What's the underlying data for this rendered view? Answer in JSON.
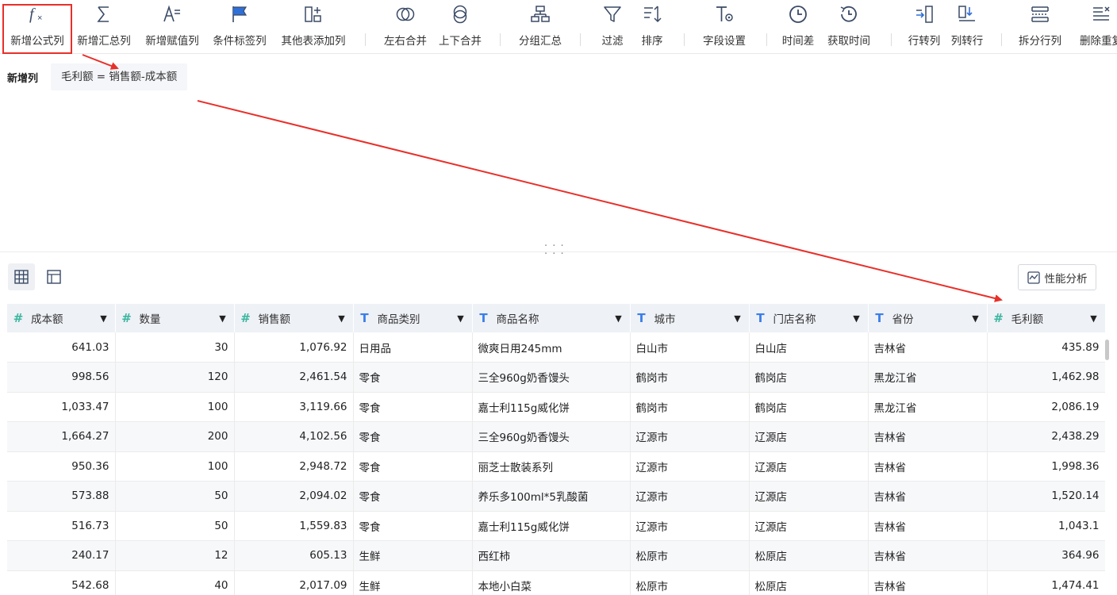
{
  "toolbar": {
    "items": [
      {
        "label": "新增公式列",
        "icon": "formula-fx-icon"
      },
      {
        "label": "新增汇总列",
        "icon": "sigma-icon"
      },
      {
        "label": "新增赋值列",
        "icon": "assign-value-icon"
      },
      {
        "label": "条件标签列",
        "icon": "condition-flag-icon"
      },
      {
        "label": "其他表添加列",
        "icon": "add-column-icon"
      },
      {
        "label": "左右合并",
        "icon": "merge-horizontal-icon"
      },
      {
        "label": "上下合并",
        "icon": "merge-vertical-icon"
      },
      {
        "label": "分组汇总",
        "icon": "group-summary-icon"
      },
      {
        "label": "过滤",
        "icon": "filter-icon"
      },
      {
        "label": "排序",
        "icon": "sort-icon"
      },
      {
        "label": "字段设置",
        "icon": "field-settings-icon"
      },
      {
        "label": "时间差",
        "icon": "clock-icon"
      },
      {
        "label": "获取时间",
        "icon": "clock-fetch-icon"
      },
      {
        "label": "行转列",
        "icon": "row-to-column-icon"
      },
      {
        "label": "列转行",
        "icon": "column-to-row-icon"
      },
      {
        "label": "拆分行列",
        "icon": "split-rows-icon"
      },
      {
        "label": "删除重复",
        "icon": "delete-duplicate-icon"
      }
    ]
  },
  "formula": {
    "section_title": "新增列",
    "expression": "毛利额 = 销售额-成本额"
  },
  "view": {
    "perf_label": "性能分析"
  },
  "table": {
    "columns": [
      {
        "name": "成本额",
        "type": "number",
        "type_icon": "#"
      },
      {
        "name": "数量",
        "type": "number",
        "type_icon": "#"
      },
      {
        "name": "销售额",
        "type": "number",
        "type_icon": "#"
      },
      {
        "name": "商品类别",
        "type": "text",
        "type_icon": "T"
      },
      {
        "name": "商品名称",
        "type": "text",
        "type_icon": "T"
      },
      {
        "name": "城市",
        "type": "text",
        "type_icon": "T"
      },
      {
        "name": "门店名称",
        "type": "text",
        "type_icon": "T"
      },
      {
        "name": "省份",
        "type": "text",
        "type_icon": "T"
      },
      {
        "name": "毛利额",
        "type": "number",
        "type_icon": "#"
      }
    ],
    "rows": [
      [
        "641.03",
        "30",
        "1,076.92",
        "日用品",
        "微爽日用245mm",
        "白山市",
        "白山店",
        "吉林省",
        "435.89"
      ],
      [
        "998.56",
        "120",
        "2,461.54",
        "零食",
        "三全960g奶香馒头",
        "鹤岗市",
        "鹤岗店",
        "黑龙江省",
        "1,462.98"
      ],
      [
        "1,033.47",
        "100",
        "3,119.66",
        "零食",
        "嘉士利115g威化饼",
        "鹤岗市",
        "鹤岗店",
        "黑龙江省",
        "2,086.19"
      ],
      [
        "1,664.27",
        "200",
        "4,102.56",
        "零食",
        "三全960g奶香馒头",
        "辽源市",
        "辽源店",
        "吉林省",
        "2,438.29"
      ],
      [
        "950.36",
        "100",
        "2,948.72",
        "零食",
        "丽芝士散装系列",
        "辽源市",
        "辽源店",
        "吉林省",
        "1,998.36"
      ],
      [
        "573.88",
        "50",
        "2,094.02",
        "零食",
        "养乐多100ml*5乳酸菌",
        "辽源市",
        "辽源店",
        "吉林省",
        "1,520.14"
      ],
      [
        "516.73",
        "50",
        "1,559.83",
        "零食",
        "嘉士利115g威化饼",
        "辽源市",
        "辽源店",
        "吉林省",
        "1,043.1"
      ],
      [
        "240.17",
        "12",
        "605.13",
        "生鲜",
        "西红柿",
        "松原市",
        "松原店",
        "吉林省",
        "364.96"
      ],
      [
        "542.68",
        "40",
        "2,017.09",
        "生鲜",
        "本地小白菜",
        "松原市",
        "松原店",
        "吉林省",
        "1,474.41"
      ]
    ]
  },
  "colors": {
    "accent_blue": "#2f6fd6",
    "annotation_red": "#e8302a",
    "number_type": "#3db6a0",
    "text_type": "#3b7ee8"
  }
}
